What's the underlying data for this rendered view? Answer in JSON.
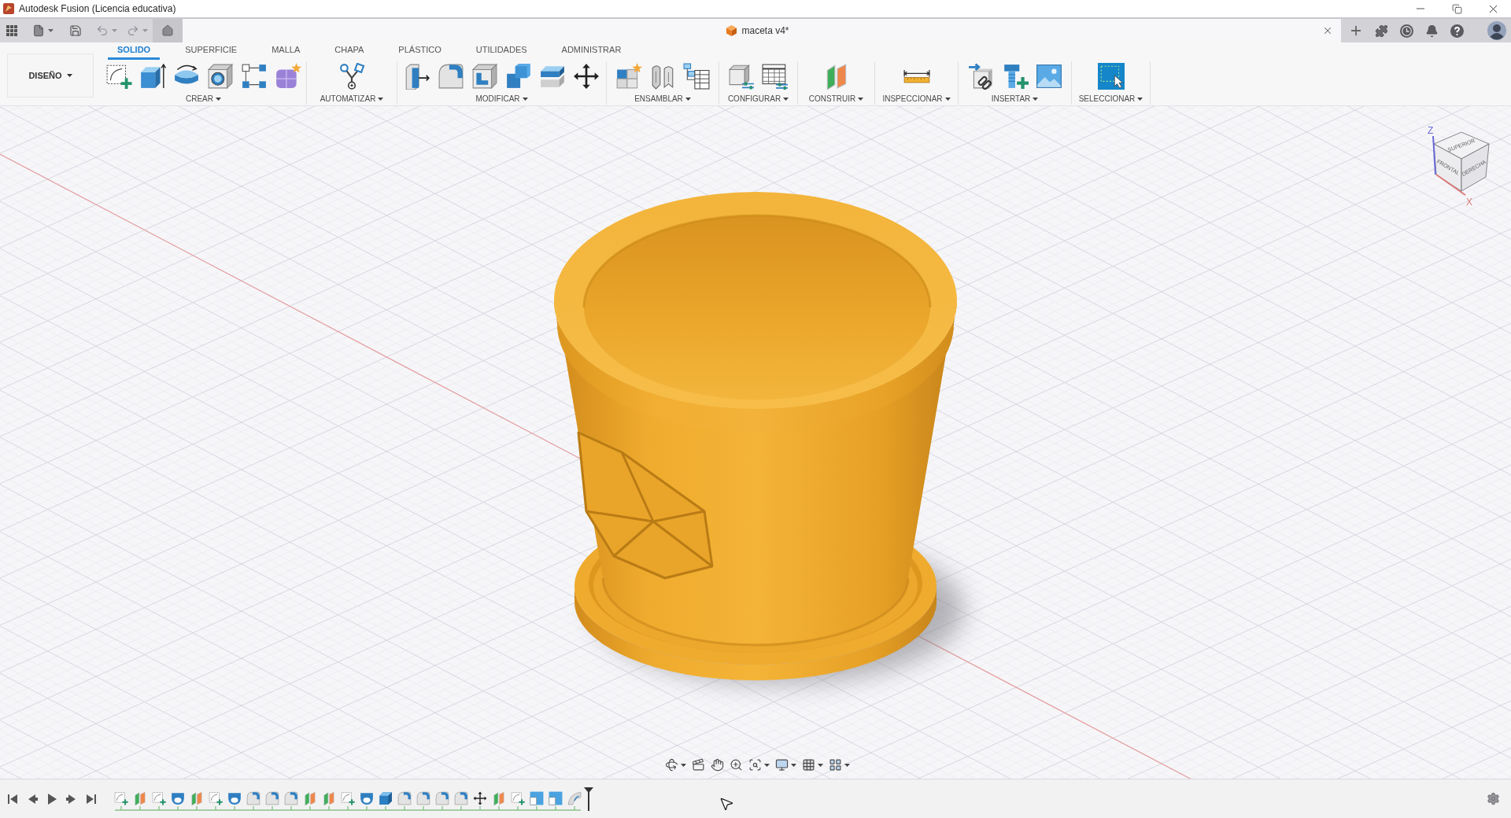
{
  "window": {
    "title": "Autodesk Fusion (Licencia educativa)"
  },
  "document_tab": {
    "title": "maceta v4*"
  },
  "workspace": {
    "label": "DISEÑO"
  },
  "tabs": [
    {
      "label": "SOLIDO",
      "selected": true
    },
    {
      "label": "SUPERFICIE",
      "selected": false
    },
    {
      "label": "MALLA",
      "selected": false
    },
    {
      "label": "CHAPA",
      "selected": false
    },
    {
      "label": "PLÁSTICO",
      "selected": false
    },
    {
      "label": "UTILIDADES",
      "selected": false
    },
    {
      "label": "ADMINISTRAR",
      "selected": false
    }
  ],
  "toolbar_groups": [
    {
      "label": "CREAR"
    },
    {
      "label": "AUTOMATIZAR"
    },
    {
      "label": "MODIFICAR"
    },
    {
      "label": "ENSAMBLAR"
    },
    {
      "label": "CONFIGURAR"
    },
    {
      "label": "CONSTRUIR"
    },
    {
      "label": "INSPECCIONAR"
    },
    {
      "label": "INSERTAR"
    },
    {
      "label": "SELECCIONAR"
    }
  ],
  "view_cube": {
    "top": "SUPERIOR",
    "front": "FRONTAL",
    "right": "DERECHA",
    "z_axis": "Z",
    "x_axis": "X"
  }
}
